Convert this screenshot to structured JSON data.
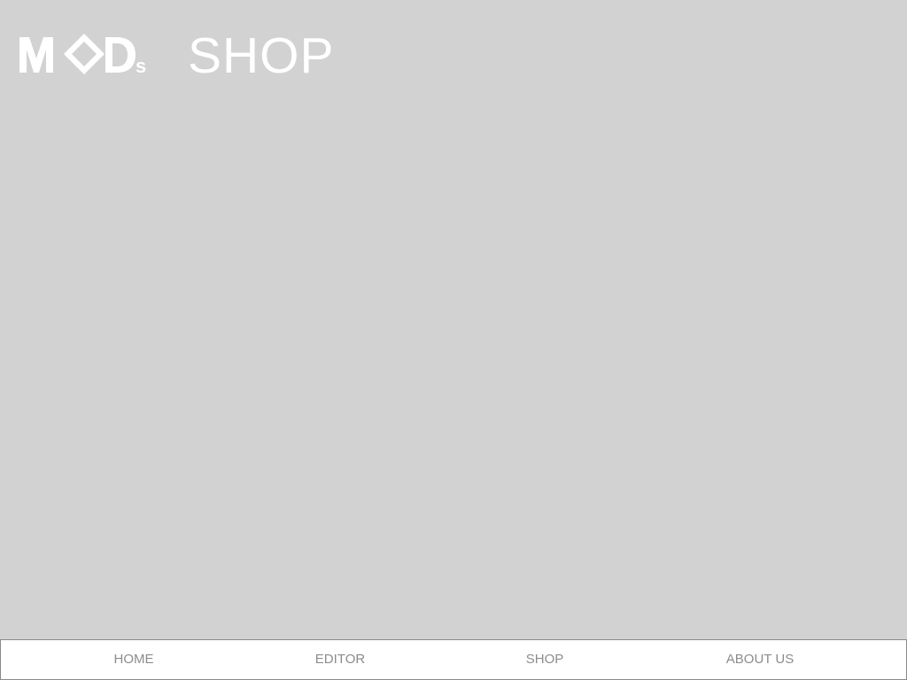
{
  "header": {
    "logo_text": "MODs",
    "title": "SHOP"
  },
  "bottom_nav": {
    "items": [
      {
        "label": "HOME"
      },
      {
        "label": "EDITOR"
      },
      {
        "label": "SHOP"
      },
      {
        "label": "ABOUT US"
      }
    ]
  },
  "colors": {
    "background": "#d2d2d2",
    "header_text": "#ffffff",
    "nav_background": "#ffffff",
    "nav_text": "#8c8c8c",
    "nav_border": "#8a8a8a"
  }
}
